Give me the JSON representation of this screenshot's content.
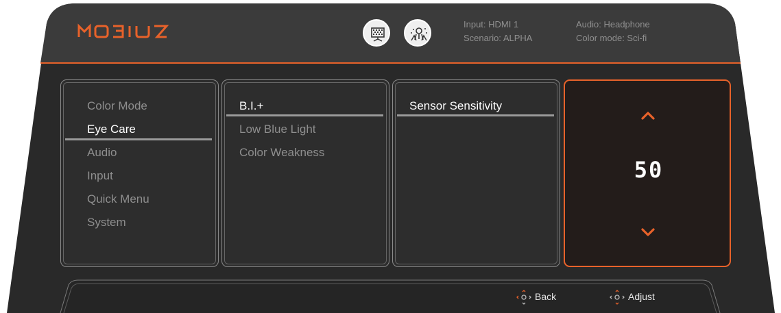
{
  "header": {
    "brand": "MOBIUZ",
    "mode_icons": [
      "game-mode-icon",
      "scenario-icon"
    ],
    "status_left": [
      "Input: HDMI 1",
      "Scenario: ALPHA"
    ],
    "status_right": [
      "Audio: Headphone",
      "Color mode: Sci-fi"
    ]
  },
  "menu": {
    "level1": [
      "Color Mode",
      "Eye Care",
      "Audio",
      "Input",
      "Quick Menu",
      "System"
    ],
    "level1_selected": "Eye Care",
    "level2": [
      "B.I.+",
      "Low Blue Light",
      "Color Weakness"
    ],
    "level2_selected": "B.I.+",
    "level3": [
      "Sensor Sensitivity"
    ],
    "level3_selected": "Sensor Sensitivity"
  },
  "adjust_panel": {
    "value": "50",
    "up_icon": "chevron-up-icon",
    "down_icon": "chevron-down-icon"
  },
  "footer": {
    "back_label": "Back",
    "adjust_label": "Adjust",
    "joystick_icon": "joystick-icon"
  },
  "colors": {
    "accent": "#e8622a",
    "background": "#2a2a2a",
    "header": "#3a3a3a"
  }
}
